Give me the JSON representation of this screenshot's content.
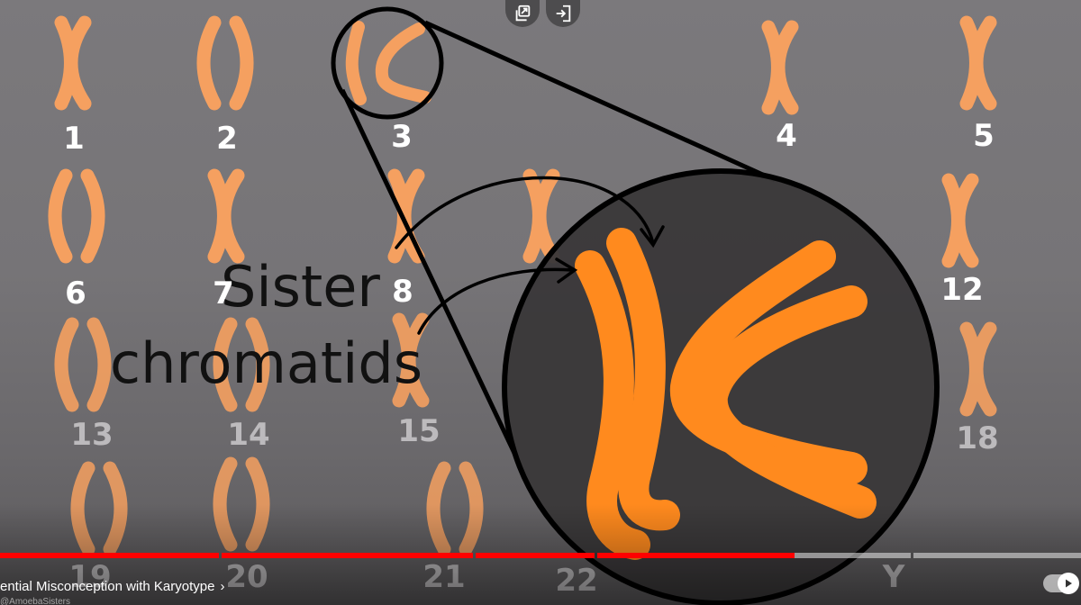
{
  "video": {
    "chapter_title": "ential Misconception with Karyotype",
    "channel": "@AmoebaSisters"
  },
  "overlay": {
    "label_line1": "Sister",
    "label_line2": "chromatids"
  },
  "chromosome_labels": {
    "c1": "1",
    "c2": "2",
    "c3": "3",
    "c4": "4",
    "c5": "5",
    "c6": "6",
    "c7": "7",
    "c8": "8",
    "c12": "12",
    "c13": "13",
    "c14": "14",
    "c15": "15",
    "c18": "18",
    "c19": "19",
    "c20": "20",
    "c21": "21",
    "c22": "22",
    "cy": "Y"
  },
  "colors": {
    "chromosome": "#f5a060",
    "chromosome_zoom": "#ff8a1e",
    "progress_played": "#ff0000",
    "zoom_fill": "#3a3839"
  },
  "progress": {
    "played_fraction": 0.735
  },
  "controls": {
    "top_left_icon": "copy-link-icon",
    "top_right_icon": "share-enter-icon",
    "autoplay_icon": "play-icon"
  }
}
